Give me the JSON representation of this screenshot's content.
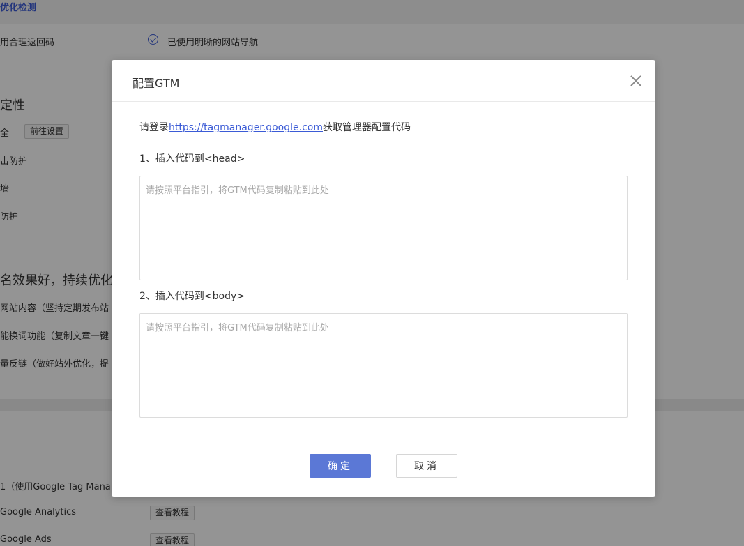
{
  "background": {
    "section_title": "优化检测",
    "rows": {
      "return_code": "用合理返回码",
      "nav_check": "已使用明晰的网站导航",
      "stability_heading": "定性",
      "security": "全",
      "goto_settings": "前往设置",
      "attack_protect": "击防护",
      "firewall": "墙",
      "protect": "防护",
      "ranking_heading": "名效果好，持续优化对",
      "content_tip": "网站内容（坚持定期发布站",
      "replace_tip": "能换词功能（复制文章一键",
      "backlink_tip": "量反链（做好站外优化，提",
      "gtm_row": "1（使用Google Tag Mana",
      "ga_row": "Google Analytics",
      "gads_row": "Google Ads",
      "tutorial_btn": "查看教程"
    }
  },
  "modal": {
    "title": "配置GTM",
    "intro_prefix": "请登录",
    "intro_link": "https://tagmanager.google.com",
    "intro_suffix": "获取管理器配置代码",
    "step1_label": "1、插入代码到<head>",
    "step2_label": "2、插入代码到<body>",
    "placeholder": "请按照平台指引，将GTM代码复制粘贴到此处",
    "head_code_value": "",
    "body_code_value": "",
    "confirm_label": "确定",
    "cancel_label": "取消",
    "close_icon": "close-icon"
  },
  "colors": {
    "accent": "#5b78d6",
    "link": "#3b5bd6",
    "overlay": "rgba(0,0,0,0.42)"
  }
}
